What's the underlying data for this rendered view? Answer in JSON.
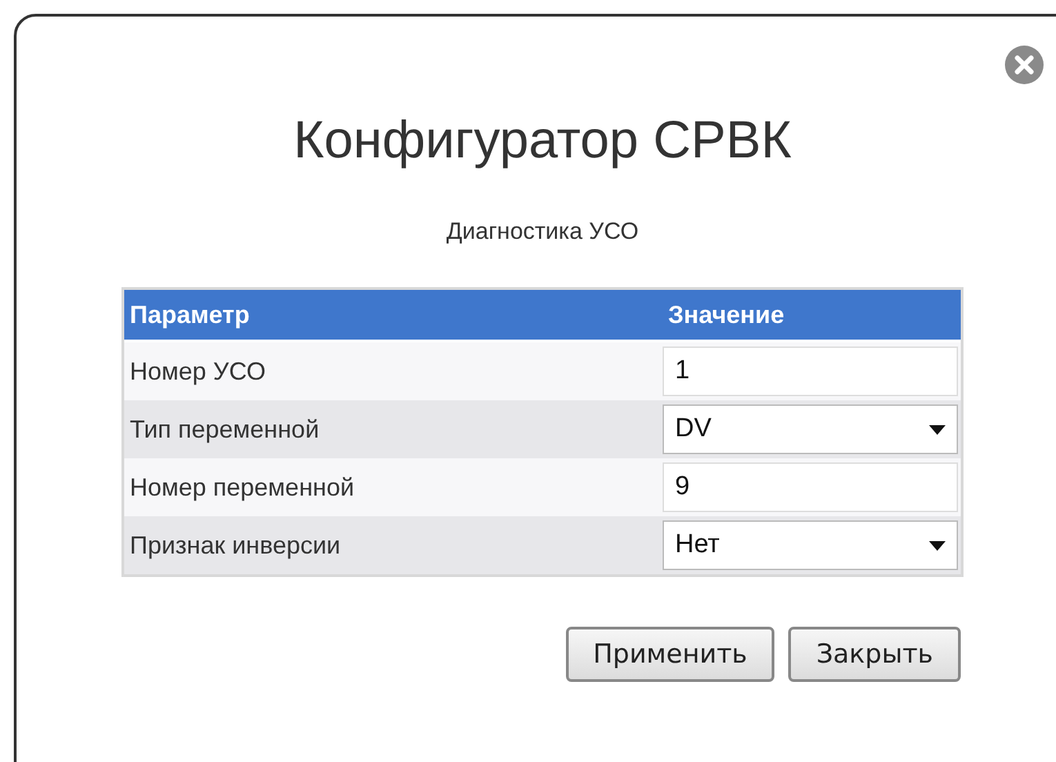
{
  "dialog": {
    "title": "Конфигуратор СРВК",
    "subtitle": "Диагностика УСО"
  },
  "table": {
    "columns": [
      "Параметр",
      "Значение"
    ],
    "rows": [
      {
        "label": "Номер УСО",
        "kind": "text",
        "value": "1"
      },
      {
        "label": "Тип переменной",
        "kind": "select",
        "value": "DV"
      },
      {
        "label": "Номер переменной",
        "kind": "text",
        "value": "9"
      },
      {
        "label": "Признак инверсии",
        "kind": "select",
        "value": "Нет"
      }
    ]
  },
  "buttons": [
    "Применить",
    "Закрыть"
  ]
}
